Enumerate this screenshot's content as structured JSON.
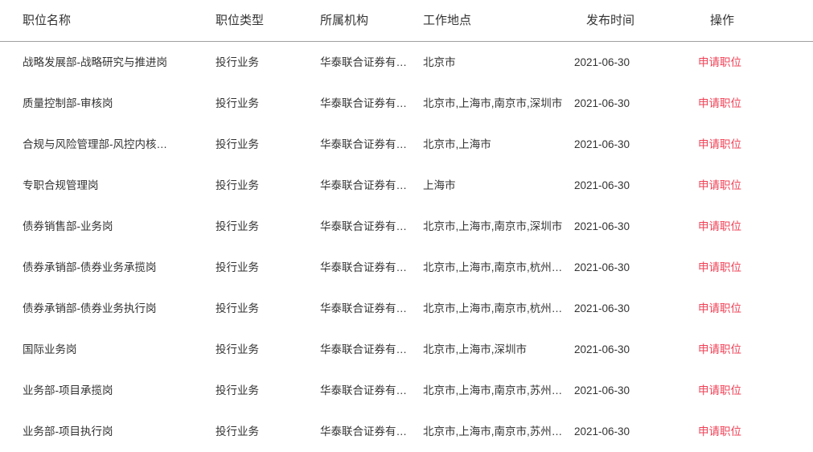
{
  "table": {
    "columns": [
      {
        "key": "name",
        "label": "职位名称"
      },
      {
        "key": "type",
        "label": "职位类型"
      },
      {
        "key": "org",
        "label": "所属机构"
      },
      {
        "key": "loc",
        "label": "工作地点"
      },
      {
        "key": "date",
        "label": "发布时间"
      },
      {
        "key": "action",
        "label": "操作"
      }
    ],
    "action_label": "申请职位",
    "accent_color": "#ef4156",
    "header_text_color": "#333333",
    "divider_color": "#a0a0a0",
    "rows": [
      {
        "name": "战略发展部-战略研究与推进岗",
        "type": "投行业务",
        "org": "华泰联合证券有…",
        "loc": "北京市",
        "date": "2021-06-30",
        "action": "申请职位"
      },
      {
        "name": "质量控制部-审核岗",
        "type": "投行业务",
        "org": "华泰联合证券有…",
        "loc": "北京市,上海市,南京市,深圳市",
        "date": "2021-06-30",
        "action": "申请职位"
      },
      {
        "name": "合规与风险管理部-风控内核…",
        "type": "投行业务",
        "org": "华泰联合证券有…",
        "loc": "北京市,上海市",
        "date": "2021-06-30",
        "action": "申请职位"
      },
      {
        "name": "专职合规管理岗",
        "type": "投行业务",
        "org": "华泰联合证券有…",
        "loc": "上海市",
        "date": "2021-06-30",
        "action": "申请职位"
      },
      {
        "name": "债券销售部-业务岗",
        "type": "投行业务",
        "org": "华泰联合证券有…",
        "loc": "北京市,上海市,南京市,深圳市",
        "date": "2021-06-30",
        "action": "申请职位"
      },
      {
        "name": "债券承销部-债券业务承揽岗",
        "type": "投行业务",
        "org": "华泰联合证券有…",
        "loc": "北京市,上海市,南京市,杭州…",
        "date": "2021-06-30",
        "action": "申请职位"
      },
      {
        "name": "债券承销部-债券业务执行岗",
        "type": "投行业务",
        "org": "华泰联合证券有…",
        "loc": "北京市,上海市,南京市,杭州…",
        "date": "2021-06-30",
        "action": "申请职位"
      },
      {
        "name": "国际业务岗",
        "type": "投行业务",
        "org": "华泰联合证券有…",
        "loc": "北京市,上海市,深圳市",
        "date": "2021-06-30",
        "action": "申请职位"
      },
      {
        "name": "业务部-项目承揽岗",
        "type": "投行业务",
        "org": "华泰联合证券有…",
        "loc": "北京市,上海市,南京市,苏州…",
        "date": "2021-06-30",
        "action": "申请职位"
      },
      {
        "name": "业务部-项目执行岗",
        "type": "投行业务",
        "org": "华泰联合证券有…",
        "loc": "北京市,上海市,南京市,苏州…",
        "date": "2021-06-30",
        "action": "申请职位"
      }
    ]
  }
}
